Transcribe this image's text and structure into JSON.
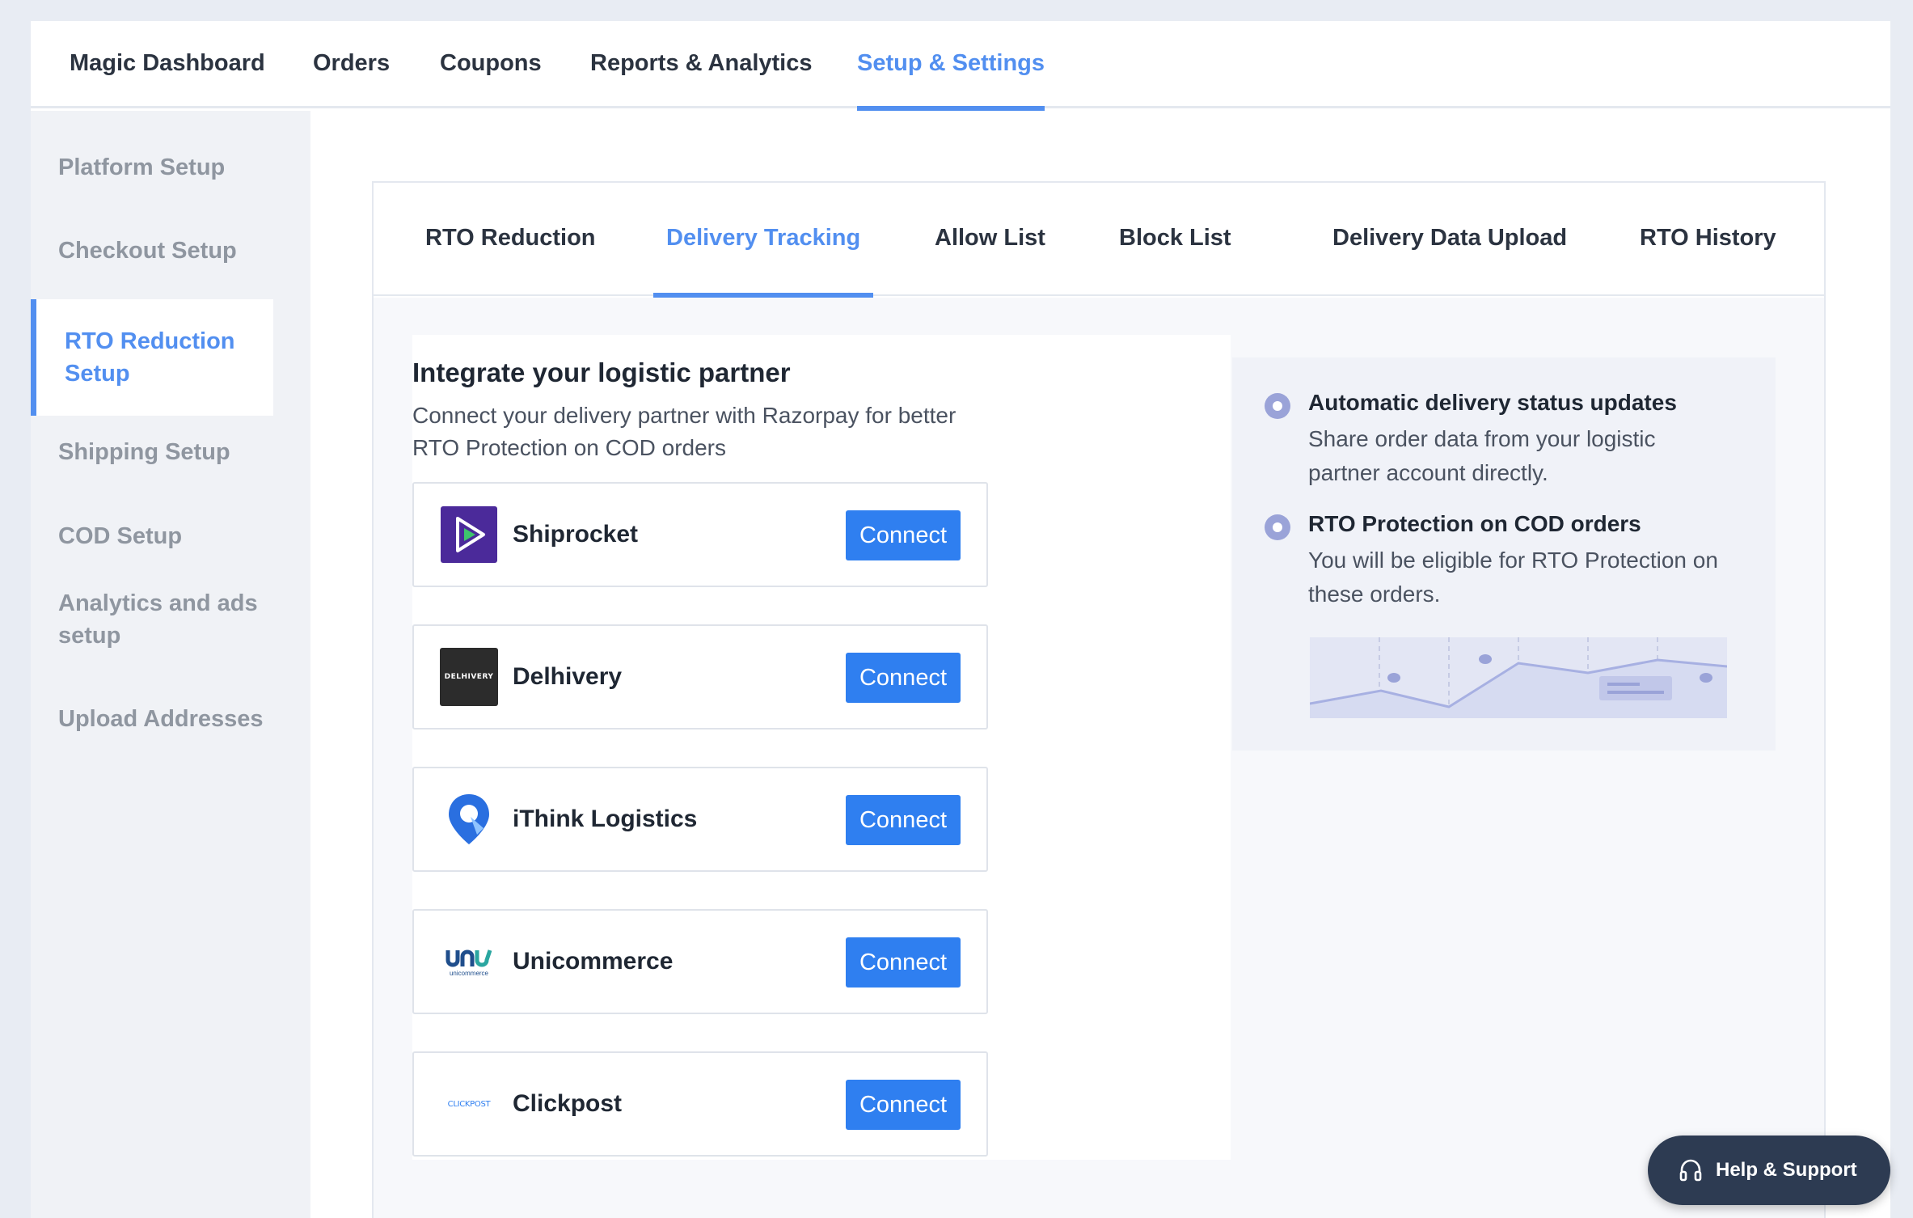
{
  "top_nav": {
    "tabs": [
      {
        "label": "Magic Dashboard",
        "active": false
      },
      {
        "label": "Orders",
        "active": false
      },
      {
        "label": "Coupons",
        "active": false
      },
      {
        "label": "Reports & Analytics",
        "active": false
      },
      {
        "label": "Setup & Settings",
        "active": true
      }
    ]
  },
  "sidebar": {
    "items": [
      {
        "label": "Platform Setup",
        "active": false
      },
      {
        "label": "Checkout Setup",
        "active": false
      },
      {
        "label": "RTO Reduction Setup",
        "active": true
      },
      {
        "label": "Shipping Setup",
        "active": false
      },
      {
        "label": "COD Setup",
        "active": false
      },
      {
        "label": "Analytics and ads setup",
        "active": false
      },
      {
        "label": "Upload Addresses",
        "active": false
      }
    ]
  },
  "sub_tabs": [
    {
      "label": "RTO Reduction",
      "active": false
    },
    {
      "label": "Delivery Tracking",
      "active": true
    },
    {
      "label": "Allow List",
      "active": false
    },
    {
      "label": "Block List",
      "active": false
    },
    {
      "label": "Delivery Data Upload",
      "active": false
    },
    {
      "label": "RTO History",
      "active": false
    }
  ],
  "integration": {
    "title": "Integrate your logistic partner",
    "subtitle": "Connect your delivery partner with Razorpay for better RTO Protection on COD orders",
    "partners": [
      {
        "name": "Shiprocket",
        "logo_icon": "shiprocket-logo-icon",
        "button": "Connect"
      },
      {
        "name": "Delhivery",
        "logo_icon": "delhivery-logo-icon",
        "logo_text": "DELHIVERY",
        "button": "Connect"
      },
      {
        "name": "iThink Logistics",
        "logo_icon": "ithink-logo-icon",
        "button": "Connect"
      },
      {
        "name": "Unicommerce",
        "logo_icon": "unicommerce-logo-icon",
        "logo_text": "unicommerce",
        "button": "Connect"
      },
      {
        "name": "Clickpost",
        "logo_icon": "clickpost-logo-icon",
        "logo_text": "CLICKPOST",
        "button": "Connect"
      }
    ]
  },
  "benefits": [
    {
      "title": "Automatic delivery status updates",
      "description": "Share order data from your logistic partner account directly."
    },
    {
      "title": "RTO Protection on COD orders",
      "description": "You will be eligible for RTO Protection on these orders."
    }
  ],
  "help": {
    "label": "Help & Support",
    "icon": "headphones-icon"
  },
  "colors": {
    "accent": "#528ff0",
    "button": "#2f7ff0",
    "help_bg": "#2d3b52",
    "radio": "#9aa3d8"
  }
}
